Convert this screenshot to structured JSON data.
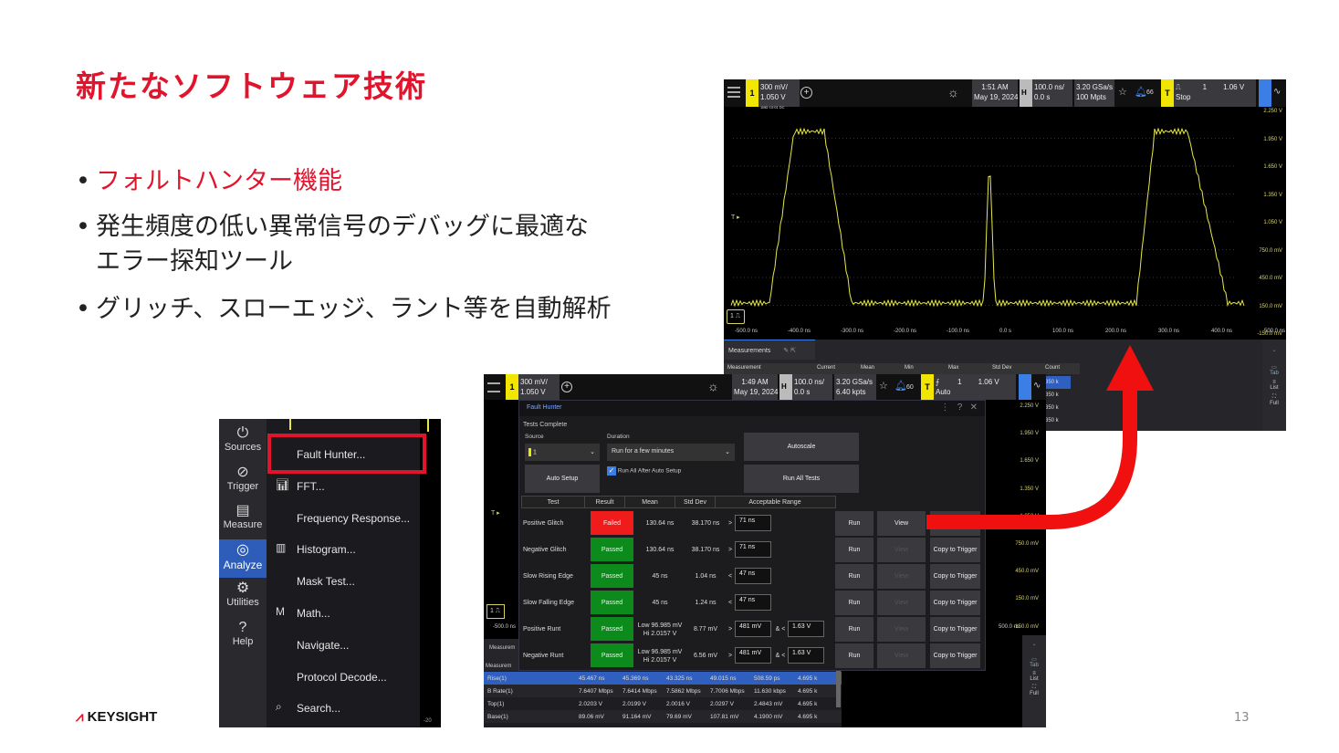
{
  "slide": {
    "title": "新たなソフトウェア技術",
    "bullets": [
      "フォルトハンター機能",
      "発生頻度の低い異常信号のデバッグに最適な",
      "エラー探知ツール",
      "グリッチ、スローエッジ、ラント等を自動解析"
    ],
    "page_number": "13",
    "logo": "KEYSIGHT",
    "accent": "#e0142c"
  },
  "scope_top": {
    "ch1": "1",
    "ch1_scale": "300 mV/",
    "ch1_offset": "1.050 V",
    "ch1_info": "1MΩ 10:01 DC",
    "time": "1:51 AM",
    "date": "May 19, 2024",
    "h": "H",
    "h_scale": "100.0 ns/",
    "h_delay": "0.0 s",
    "rate": "3.20 GSa/s",
    "points": "100 Mpts",
    "bell_count": "66",
    "t": "T",
    "trig_mode": "Stop",
    "trig_ch": "1",
    "trig_level": "1.06 V",
    "y_ticks": [
      "2.250 V",
      "1.950 V",
      "1.650 V",
      "1.350 V",
      "1.050 V",
      "750.0 mV",
      "450.0 mV",
      "150.0 mV",
      "-150.0 mV"
    ],
    "x_ticks": [
      "-500.0 ns",
      "-400.0 ns",
      "-300.0 ns",
      "-200.0 ns",
      "-100.0 ns",
      "0.0 s",
      "100.0 ns",
      "200.0 ns",
      "300.0 ns",
      "400.0 ns",
      "500.0 ns"
    ],
    "meas_tab": "Measurements",
    "meas_headers": [
      "Measurement",
      "Current",
      "Mean",
      "Min",
      "Max",
      "Std Dev",
      "Count"
    ],
    "counts": [
      "350 k",
      "350 k",
      "350 k",
      "350 k"
    ],
    "side": [
      "Tab",
      "List",
      "Full"
    ],
    "trace_color": "#e6e84a"
  },
  "scope_b": {
    "ch1": "1",
    "ch1_scale": "300 mV/",
    "ch1_offset": "1.050 V",
    "ch1_info": "1MΩ 10:01 DC",
    "time": "1:49 AM",
    "date": "May 19, 2024",
    "h": "H",
    "h_scale": "100.0 ns/",
    "h_delay": "0.0 s",
    "rate": "3.20 GSa/s",
    "points": "6.40 kpts",
    "bell_count": "60",
    "t": "T",
    "trig_mode": "Auto",
    "trig_ch": "1",
    "trig_level": "1.06 V",
    "y_ticks": [
      "2.250 V",
      "1.950 V",
      "1.650 V",
      "1.350 V",
      "1.050 V",
      "750.0 mV",
      "450.0 mV",
      "150.0 mV",
      "-150.0 mV"
    ],
    "x_first": "-500.0 ns",
    "x_last": "500.0 ns",
    "meas_label": "Measurem",
    "side": [
      "Tab",
      "List",
      "Full"
    ],
    "meas_rows": [
      [
        "Rise(1)",
        "45.467 ns",
        "45.369 ns",
        "43.325 ns",
        "49.015 ns",
        "508.59 ps",
        "4.695 k"
      ],
      [
        "B Rate(1)",
        "7.6407 Mbps",
        "7.6414 Mbps",
        "7.5862 Mbps",
        "7.7006 Mbps",
        "11.630 kbps",
        "4.695 k"
      ],
      [
        "Top(1)",
        "2.0203 V",
        "2.0199 V",
        "2.0016 V",
        "2.0297 V",
        "2.4843 mV",
        "4.695 k"
      ],
      [
        "Base(1)",
        "89.06 mV",
        "91.164 mV",
        "79.69 mV",
        "107.81 mV",
        "4.1900 mV",
        "4.695 k"
      ]
    ]
  },
  "fault_hunter": {
    "title": "Fault Hunter",
    "status": "Tests Complete",
    "source_label": "Source",
    "source_value": "1",
    "duration_label": "Duration",
    "duration_value": "Run for a few minutes",
    "autoscale": "Autoscale",
    "auto_setup": "Auto Setup",
    "run_all_after": "Run All After Auto Setup",
    "run_all_after_checked": true,
    "run_all": "Run All Tests",
    "headers": [
      "Test",
      "Result",
      "Mean",
      "Std Dev",
      "Acceptable Range"
    ],
    "rows": [
      {
        "test": "Positive Glitch",
        "result": "Failed",
        "mean": "130.64 ns",
        "std": "38.170 ns",
        "op": ">",
        "range": "71 ns",
        "run": "Run",
        "view": "View",
        "copy": ""
      },
      {
        "test": "Negative Glitch",
        "result": "Passed",
        "mean": "130.64 ns",
        "std": "38.170 ns",
        "op": ">",
        "range": "71 ns",
        "run": "Run",
        "view": "View",
        "copy": "Copy to Trigger"
      },
      {
        "test": "Slow Rising Edge",
        "result": "Passed",
        "mean": "45 ns",
        "std": "1.04 ns",
        "op": "<",
        "range": "47 ns",
        "run": "Run",
        "view": "View",
        "copy": "Copy to Trigger"
      },
      {
        "test": "Slow Falling Edge",
        "result": "Passed",
        "mean": "45 ns",
        "std": "1.24 ns",
        "op": "<",
        "range": "47 ns",
        "run": "Run",
        "view": "View",
        "copy": "Copy to Trigger"
      },
      {
        "test": "Positive Runt",
        "result": "Passed",
        "mean": "Low 96.985 mV Hi 2.0157 V",
        "std": "8.77 mV",
        "op": ">",
        "range": "481 mV",
        "op2": "& <",
        "range2": "1.63 V",
        "run": "Run",
        "view": "View",
        "copy": "Copy to Trigger"
      },
      {
        "test": "Negative Runt",
        "result": "Passed",
        "mean": "Low 96.985 mV Hi 2.0157 V",
        "std": "6.56 mV",
        "op": ">",
        "range": "481 mV",
        "op2": "& <",
        "range2": "1.63 V",
        "run": "Run",
        "view": "View",
        "copy": "Copy to Trigger"
      }
    ],
    "fail_color": "#f01c1c",
    "pass_color": "#0c8a1c"
  },
  "menu": {
    "side": [
      "Sources",
      "Trigger",
      "Measure",
      "Analyze",
      "Utilities",
      "Help"
    ],
    "active": "Analyze",
    "items": [
      "Fault Hunter...",
      "FFT...",
      "Frequency Response...",
      "Histogram...",
      "Mask Test...",
      "Math...",
      "Navigate...",
      "Protocol Decode...",
      "Search..."
    ],
    "highlight": "Fault Hunter..."
  }
}
